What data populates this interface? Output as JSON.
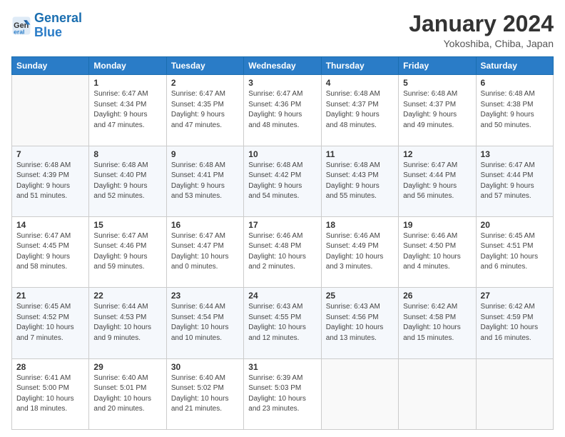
{
  "header": {
    "logo": {
      "general": "General",
      "blue": "Blue"
    },
    "title": "January 2024",
    "subtitle": "Yokoshiba, Chiba, Japan"
  },
  "columns": [
    "Sunday",
    "Monday",
    "Tuesday",
    "Wednesday",
    "Thursday",
    "Friday",
    "Saturday"
  ],
  "weeks": [
    [
      {
        "num": "",
        "info": ""
      },
      {
        "num": "1",
        "info": "Sunrise: 6:47 AM\nSunset: 4:34 PM\nDaylight: 9 hours\nand 47 minutes."
      },
      {
        "num": "2",
        "info": "Sunrise: 6:47 AM\nSunset: 4:35 PM\nDaylight: 9 hours\nand 47 minutes."
      },
      {
        "num": "3",
        "info": "Sunrise: 6:47 AM\nSunset: 4:36 PM\nDaylight: 9 hours\nand 48 minutes."
      },
      {
        "num": "4",
        "info": "Sunrise: 6:48 AM\nSunset: 4:37 PM\nDaylight: 9 hours\nand 48 minutes."
      },
      {
        "num": "5",
        "info": "Sunrise: 6:48 AM\nSunset: 4:37 PM\nDaylight: 9 hours\nand 49 minutes."
      },
      {
        "num": "6",
        "info": "Sunrise: 6:48 AM\nSunset: 4:38 PM\nDaylight: 9 hours\nand 50 minutes."
      }
    ],
    [
      {
        "num": "7",
        "info": "Sunrise: 6:48 AM\nSunset: 4:39 PM\nDaylight: 9 hours\nand 51 minutes."
      },
      {
        "num": "8",
        "info": "Sunrise: 6:48 AM\nSunset: 4:40 PM\nDaylight: 9 hours\nand 52 minutes."
      },
      {
        "num": "9",
        "info": "Sunrise: 6:48 AM\nSunset: 4:41 PM\nDaylight: 9 hours\nand 53 minutes."
      },
      {
        "num": "10",
        "info": "Sunrise: 6:48 AM\nSunset: 4:42 PM\nDaylight: 9 hours\nand 54 minutes."
      },
      {
        "num": "11",
        "info": "Sunrise: 6:48 AM\nSunset: 4:43 PM\nDaylight: 9 hours\nand 55 minutes."
      },
      {
        "num": "12",
        "info": "Sunrise: 6:47 AM\nSunset: 4:44 PM\nDaylight: 9 hours\nand 56 minutes."
      },
      {
        "num": "13",
        "info": "Sunrise: 6:47 AM\nSunset: 4:44 PM\nDaylight: 9 hours\nand 57 minutes."
      }
    ],
    [
      {
        "num": "14",
        "info": "Sunrise: 6:47 AM\nSunset: 4:45 PM\nDaylight: 9 hours\nand 58 minutes."
      },
      {
        "num": "15",
        "info": "Sunrise: 6:47 AM\nSunset: 4:46 PM\nDaylight: 9 hours\nand 59 minutes."
      },
      {
        "num": "16",
        "info": "Sunrise: 6:47 AM\nSunset: 4:47 PM\nDaylight: 10 hours\nand 0 minutes."
      },
      {
        "num": "17",
        "info": "Sunrise: 6:46 AM\nSunset: 4:48 PM\nDaylight: 10 hours\nand 2 minutes."
      },
      {
        "num": "18",
        "info": "Sunrise: 6:46 AM\nSunset: 4:49 PM\nDaylight: 10 hours\nand 3 minutes."
      },
      {
        "num": "19",
        "info": "Sunrise: 6:46 AM\nSunset: 4:50 PM\nDaylight: 10 hours\nand 4 minutes."
      },
      {
        "num": "20",
        "info": "Sunrise: 6:45 AM\nSunset: 4:51 PM\nDaylight: 10 hours\nand 6 minutes."
      }
    ],
    [
      {
        "num": "21",
        "info": "Sunrise: 6:45 AM\nSunset: 4:52 PM\nDaylight: 10 hours\nand 7 minutes."
      },
      {
        "num": "22",
        "info": "Sunrise: 6:44 AM\nSunset: 4:53 PM\nDaylight: 10 hours\nand 9 minutes."
      },
      {
        "num": "23",
        "info": "Sunrise: 6:44 AM\nSunset: 4:54 PM\nDaylight: 10 hours\nand 10 minutes."
      },
      {
        "num": "24",
        "info": "Sunrise: 6:43 AM\nSunset: 4:55 PM\nDaylight: 10 hours\nand 12 minutes."
      },
      {
        "num": "25",
        "info": "Sunrise: 6:43 AM\nSunset: 4:56 PM\nDaylight: 10 hours\nand 13 minutes."
      },
      {
        "num": "26",
        "info": "Sunrise: 6:42 AM\nSunset: 4:58 PM\nDaylight: 10 hours\nand 15 minutes."
      },
      {
        "num": "27",
        "info": "Sunrise: 6:42 AM\nSunset: 4:59 PM\nDaylight: 10 hours\nand 16 minutes."
      }
    ],
    [
      {
        "num": "28",
        "info": "Sunrise: 6:41 AM\nSunset: 5:00 PM\nDaylight: 10 hours\nand 18 minutes."
      },
      {
        "num": "29",
        "info": "Sunrise: 6:40 AM\nSunset: 5:01 PM\nDaylight: 10 hours\nand 20 minutes."
      },
      {
        "num": "30",
        "info": "Sunrise: 6:40 AM\nSunset: 5:02 PM\nDaylight: 10 hours\nand 21 minutes."
      },
      {
        "num": "31",
        "info": "Sunrise: 6:39 AM\nSunset: 5:03 PM\nDaylight: 10 hours\nand 23 minutes."
      },
      {
        "num": "",
        "info": ""
      },
      {
        "num": "",
        "info": ""
      },
      {
        "num": "",
        "info": ""
      }
    ]
  ]
}
